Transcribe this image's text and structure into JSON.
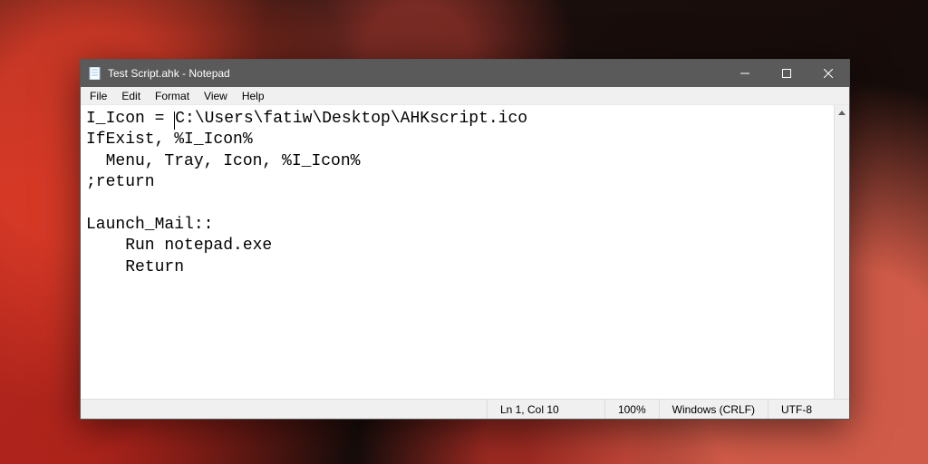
{
  "window": {
    "title": "Test Script.ahk - Notepad"
  },
  "menu": {
    "file": "File",
    "edit": "Edit",
    "format": "Format",
    "view": "View",
    "help": "Help"
  },
  "editor": {
    "line1_before_caret": "I_Icon = ",
    "line1_after_caret": "C:\\Users\\fatiw\\Desktop\\AHKscript.ico",
    "line2": "IfExist, %I_Icon%",
    "line3": "  Menu, Tray, Icon, %I_Icon%",
    "line4": ";return",
    "line5": "",
    "line6": "Launch_Mail::",
    "line7": "    Run notepad.exe",
    "line8": "    Return"
  },
  "status": {
    "position": "Ln 1, Col 10",
    "zoom": "100%",
    "line_end": "Windows (CRLF)",
    "encoding": "UTF-8"
  }
}
